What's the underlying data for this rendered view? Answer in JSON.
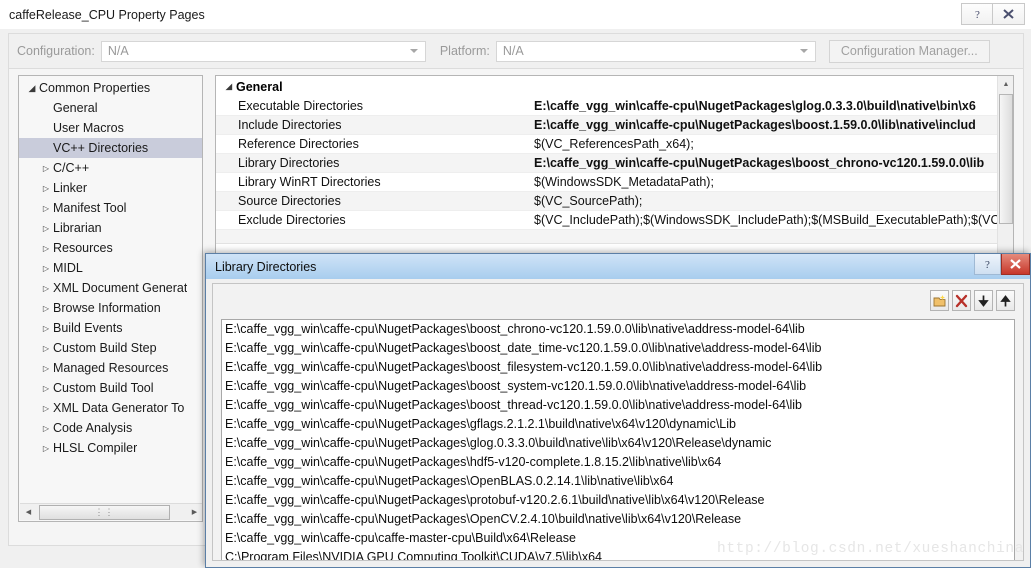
{
  "window": {
    "title": "caffeRelease_CPU Property Pages",
    "buttons": [
      {
        "name": "help-button",
        "glyph": "?"
      },
      {
        "name": "close-button",
        "glyph": "✕"
      }
    ]
  },
  "config_bar": {
    "configuration_label": "Configuration:",
    "configuration_value": "N/A",
    "platform_label": "Platform:",
    "platform_value": "N/A",
    "configuration_manager_label": "Configuration Manager..."
  },
  "tree": {
    "items": [
      {
        "label": "Common Properties",
        "indent": 0,
        "arrow": "expanded",
        "selected": false
      },
      {
        "label": "General",
        "indent": 1,
        "arrow": "none",
        "selected": false
      },
      {
        "label": "User Macros",
        "indent": 1,
        "arrow": "none",
        "selected": false
      },
      {
        "label": "VC++ Directories",
        "indent": 1,
        "arrow": "none",
        "selected": true
      },
      {
        "label": "C/C++",
        "indent": 1,
        "arrow": "collapsed",
        "selected": false
      },
      {
        "label": "Linker",
        "indent": 1,
        "arrow": "collapsed",
        "selected": false
      },
      {
        "label": "Manifest Tool",
        "indent": 1,
        "arrow": "collapsed",
        "selected": false
      },
      {
        "label": "Librarian",
        "indent": 1,
        "arrow": "collapsed",
        "selected": false
      },
      {
        "label": "Resources",
        "indent": 1,
        "arrow": "collapsed",
        "selected": false
      },
      {
        "label": "MIDL",
        "indent": 1,
        "arrow": "collapsed",
        "selected": false
      },
      {
        "label": "XML Document Generat",
        "indent": 1,
        "arrow": "collapsed",
        "selected": false
      },
      {
        "label": "Browse Information",
        "indent": 1,
        "arrow": "collapsed",
        "selected": false
      },
      {
        "label": "Build Events",
        "indent": 1,
        "arrow": "collapsed",
        "selected": false
      },
      {
        "label": "Custom Build Step",
        "indent": 1,
        "arrow": "collapsed",
        "selected": false
      },
      {
        "label": "Managed Resources",
        "indent": 1,
        "arrow": "collapsed",
        "selected": false
      },
      {
        "label": "Custom Build Tool",
        "indent": 1,
        "arrow": "collapsed",
        "selected": false
      },
      {
        "label": "XML Data Generator To",
        "indent": 1,
        "arrow": "collapsed",
        "selected": false
      },
      {
        "label": "Code Analysis",
        "indent": 1,
        "arrow": "collapsed",
        "selected": false
      },
      {
        "label": "HLSL Compiler",
        "indent": 1,
        "arrow": "collapsed",
        "selected": false
      }
    ]
  },
  "grid": {
    "category": "General",
    "rows": [
      {
        "name": "Executable Directories",
        "value": "E:\\caffe_vgg_win\\caffe-cpu\\NugetPackages\\glog.0.3.3.0\\build\\native\\bin\\x6",
        "bold": true
      },
      {
        "name": "Include Directories",
        "value": "E:\\caffe_vgg_win\\caffe-cpu\\NugetPackages\\boost.1.59.0.0\\lib\\native\\includ",
        "bold": true
      },
      {
        "name": "Reference Directories",
        "value": "$(VC_ReferencesPath_x64);",
        "bold": false
      },
      {
        "name": "Library Directories",
        "value": "E:\\caffe_vgg_win\\caffe-cpu\\NugetPackages\\boost_chrono-vc120.1.59.0.0\\lib",
        "bold": true
      },
      {
        "name": "Library WinRT Directories",
        "value": "$(WindowsSDK_MetadataPath);",
        "bold": false
      },
      {
        "name": "Source Directories",
        "value": "$(VC_SourcePath);",
        "bold": false
      },
      {
        "name": "Exclude Directories",
        "value": "$(VC_IncludePath);$(WindowsSDK_IncludePath);$(MSBuild_ExecutablePath);$(VC",
        "bold": false
      }
    ]
  },
  "dialog": {
    "title": "Library Directories",
    "buttons": [
      {
        "name": "dialog-help-button",
        "glyph": "?"
      },
      {
        "name": "dialog-close-button",
        "glyph": "✕"
      }
    ],
    "toolbar": [
      {
        "name": "new-line-button",
        "icon": "new-folder-icon"
      },
      {
        "name": "delete-button",
        "icon": "delete-x-icon"
      },
      {
        "name": "move-down-button",
        "icon": "arrow-down-icon"
      },
      {
        "name": "move-up-button",
        "icon": "arrow-up-icon"
      }
    ],
    "list": [
      "E:\\caffe_vgg_win\\caffe-cpu\\NugetPackages\\boost_chrono-vc120.1.59.0.0\\lib\\native\\address-model-64\\lib",
      "E:\\caffe_vgg_win\\caffe-cpu\\NugetPackages\\boost_date_time-vc120.1.59.0.0\\lib\\native\\address-model-64\\lib",
      "E:\\caffe_vgg_win\\caffe-cpu\\NugetPackages\\boost_filesystem-vc120.1.59.0.0\\lib\\native\\address-model-64\\lib",
      "E:\\caffe_vgg_win\\caffe-cpu\\NugetPackages\\boost_system-vc120.1.59.0.0\\lib\\native\\address-model-64\\lib",
      "E:\\caffe_vgg_win\\caffe-cpu\\NugetPackages\\boost_thread-vc120.1.59.0.0\\lib\\native\\address-model-64\\lib",
      "E:\\caffe_vgg_win\\caffe-cpu\\NugetPackages\\gflags.2.1.2.1\\build\\native\\x64\\v120\\dynamic\\Lib",
      "E:\\caffe_vgg_win\\caffe-cpu\\NugetPackages\\glog.0.3.3.0\\build\\native\\lib\\x64\\v120\\Release\\dynamic",
      "E:\\caffe_vgg_win\\caffe-cpu\\NugetPackages\\hdf5-v120-complete.1.8.15.2\\lib\\native\\lib\\x64",
      "E:\\caffe_vgg_win\\caffe-cpu\\NugetPackages\\OpenBLAS.0.2.14.1\\lib\\native\\lib\\x64",
      "E:\\caffe_vgg_win\\caffe-cpu\\NugetPackages\\protobuf-v120.2.6.1\\build\\native\\lib\\x64\\v120\\Release",
      "E:\\caffe_vgg_win\\caffe-cpu\\NugetPackages\\OpenCV.2.4.10\\build\\native\\lib\\x64\\v120\\Release",
      "E:\\caffe_vgg_win\\caffe-cpu\\caffe-master-cpu\\Build\\x64\\Release",
      "C:\\Program Files\\NVIDIA GPU Computing Toolkit\\CUDA\\v7.5\\lib\\x64"
    ]
  },
  "watermark": {
    "text": "http://blog.csdn.net/xueshanchina"
  },
  "colors": {
    "selection": "#c9ccdb",
    "dialog_title_gradient_start": "#cfe3f7",
    "dialog_title_gradient_end": "#a8cdee",
    "close_red": "#c7372b",
    "delete_icon_red": "#b8312a"
  }
}
